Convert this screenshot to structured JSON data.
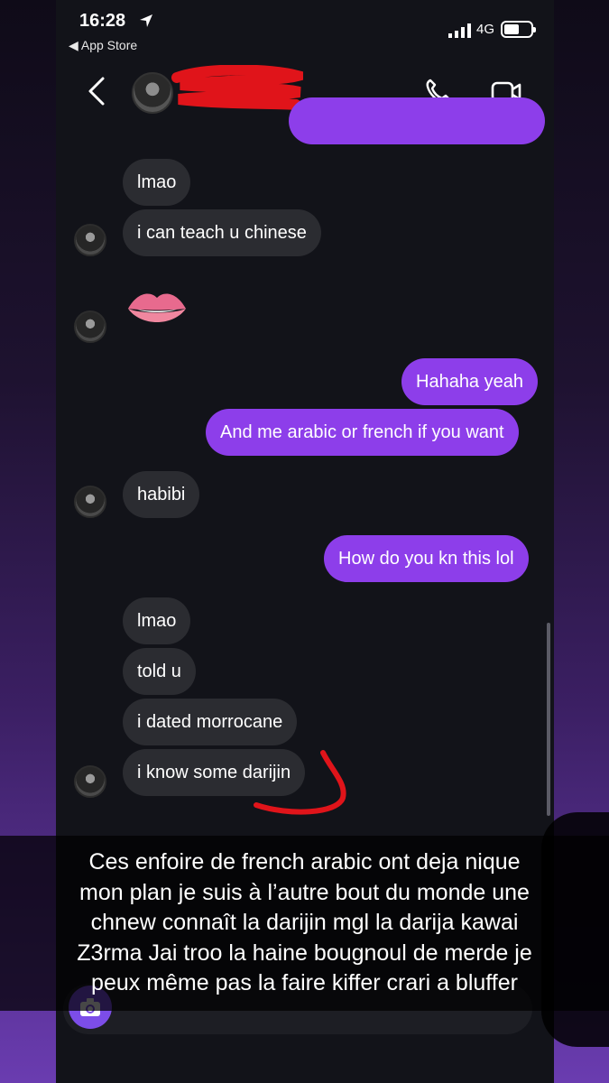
{
  "status_bar": {
    "time": "16:28",
    "back_app": "◀ App Store",
    "network": "4G"
  },
  "header": {
    "contact_name": ""
  },
  "messages": {
    "m1": "lmao",
    "m2": "i can teach u chinese",
    "m3_emoji": "👄",
    "m4": "Hahaha yeah",
    "m5": "And me arabic or french if you want",
    "m6": "habibi",
    "m7": "How do you kn this lol",
    "m8": "lmao",
    "m9": "told u",
    "m10": "i dated morrocane",
    "m11": "i know some darijin"
  },
  "caption": {
    "lines": [
      "Ces enfoire de french arabic ont deja nique",
      "mon plan je suis à l’autre bout du monde une",
      "chnew connaît la darijin mgl la darija kawai",
      "Z3rma Jai troo la haine bougnoul de merde je",
      "peux même pas la faire kiffer crari a bluffer"
    ]
  },
  "colors": {
    "outgoing": "#8d3eea",
    "incoming": "#2b2c31",
    "background": "#121319",
    "redaction": "#e0141a"
  }
}
